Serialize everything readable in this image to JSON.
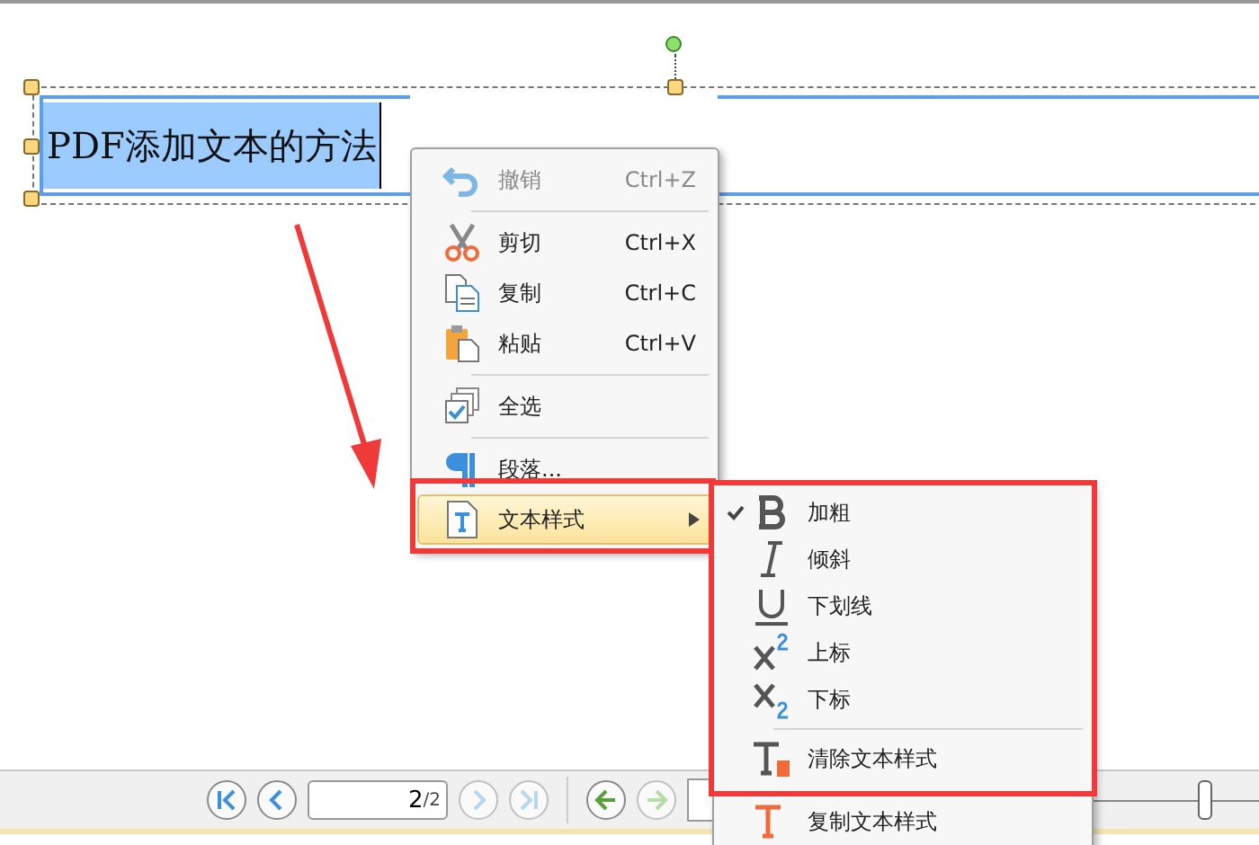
{
  "canvas": {
    "text": "PDF添加文本的方法"
  },
  "context_menu": {
    "items": [
      {
        "kind": "command",
        "label": "撤销",
        "shortcut": "Ctrl+Z",
        "disabled": true,
        "selected": false
      },
      {
        "kind": "separator"
      },
      {
        "kind": "command",
        "label": "剪切",
        "shortcut": "Ctrl+X",
        "disabled": false,
        "selected": false
      },
      {
        "kind": "command",
        "label": "复制",
        "shortcut": "Ctrl+C",
        "disabled": false,
        "selected": false
      },
      {
        "kind": "command",
        "label": "粘贴",
        "shortcut": "Ctrl+V",
        "disabled": false,
        "selected": false
      },
      {
        "kind": "separator"
      },
      {
        "kind": "command",
        "label": "全选",
        "disabled": false,
        "selected": false
      },
      {
        "kind": "separator"
      },
      {
        "kind": "command",
        "label": "段落...",
        "disabled": false,
        "selected": false
      },
      {
        "kind": "submenu",
        "label": "文本样式",
        "disabled": false,
        "selected": true
      }
    ]
  },
  "submenu": {
    "items": [
      {
        "kind": "command",
        "label": "加粗",
        "checked": true
      },
      {
        "kind": "command",
        "label": "倾斜",
        "checked": false
      },
      {
        "kind": "command",
        "label": "下划线",
        "checked": false
      },
      {
        "kind": "command",
        "label": "上标",
        "checked": false
      },
      {
        "kind": "command",
        "label": "下标",
        "checked": false
      },
      {
        "kind": "separator"
      },
      {
        "kind": "command",
        "label": "清除文本样式",
        "checked": false
      },
      {
        "kind": "command",
        "label": "复制文本样式",
        "checked": false
      }
    ]
  },
  "toolbar": {
    "page_field": {
      "value": "2",
      "total": "/2"
    },
    "nav_buttons": [
      {
        "disabled": false
      },
      {
        "disabled": false
      },
      {
        "disabled": true
      },
      {
        "disabled": true
      }
    ],
    "history_buttons": [
      {
        "disabled": false
      },
      {
        "disabled": true
      }
    ],
    "zoom_slider": {
      "level": 0.7
    }
  }
}
